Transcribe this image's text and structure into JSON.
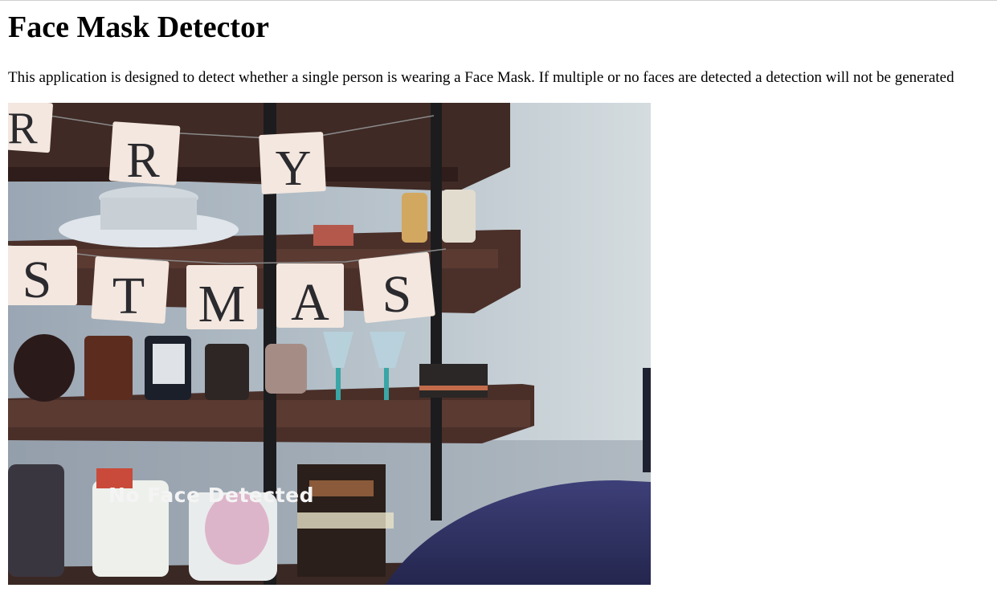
{
  "page": {
    "title": "Face Mask Detector",
    "description": "This application is designed to detect whether a single person is wearing a Face Mask. If multiple or no faces are detected a detection will not be generated"
  },
  "video_feed": {
    "overlay_text": "No Face Detected",
    "banner_letters_top": [
      "R",
      "R",
      "Y"
    ],
    "banner_letters_bottom": [
      "S",
      "T",
      "M",
      "A",
      "S"
    ]
  }
}
